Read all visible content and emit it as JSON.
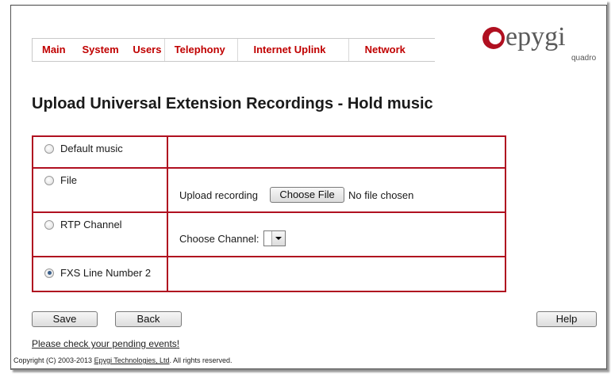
{
  "menu": {
    "items": [
      "Main",
      "System",
      "Users",
      "Telephony",
      "Internet Uplink",
      "Network"
    ]
  },
  "logo": {
    "text": "epygi",
    "sub": "quadro"
  },
  "page": {
    "title": "Upload Universal Extension Recordings - Hold music"
  },
  "options": {
    "default_music": {
      "label": "Default music",
      "checked": false
    },
    "file": {
      "label": "File",
      "checked": false,
      "upload_label": "Upload recording",
      "choose_button": "Choose File",
      "no_file_text": "No file chosen"
    },
    "rtp": {
      "label": "RTP Channel",
      "checked": false,
      "channel_label": "Choose Channel:",
      "channel_value": ""
    },
    "fxs": {
      "label": "FXS Line Number 2",
      "checked": true
    }
  },
  "buttons": {
    "save": "Save",
    "back": "Back",
    "help": "Help"
  },
  "footer": {
    "pending_link": "Please check your pending events!",
    "copyright_prefix": "Copyright (C) 2003-2013 ",
    "copyright_link": "Epygi Technologies, Ltd",
    "copyright_suffix": ". All rights reserved."
  },
  "colors": {
    "accent": "#b01020",
    "menu_text": "#c00000"
  }
}
